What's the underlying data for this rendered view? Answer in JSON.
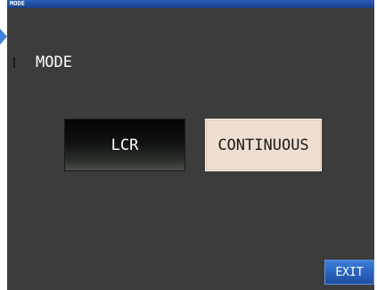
{
  "window": {
    "title": "MODE"
  },
  "main": {
    "heading": "MODE",
    "modes": [
      {
        "label": "LCR",
        "selected": false
      },
      {
        "label": "CONTINUOUS",
        "selected": true
      }
    ]
  },
  "footer": {
    "exit_label": "EXIT"
  },
  "colors": {
    "title_bar": "#1d4a9c",
    "background": "#3c3c3c",
    "selected_button": "#eedfd2",
    "exit_button": "#2a64bf",
    "side_marker": "#3f7fd6"
  },
  "icons": {
    "side_marker": "side-pointer-triangle-icon"
  }
}
